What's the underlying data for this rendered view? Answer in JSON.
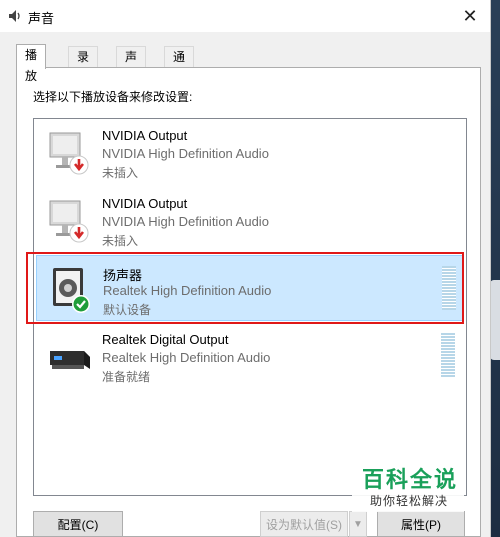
{
  "window": {
    "title": "声音",
    "close_glyph": "✕"
  },
  "tabs": [
    {
      "label": "播放",
      "active": true
    },
    {
      "label": "录制",
      "active": false
    },
    {
      "label": "声音",
      "active": false
    },
    {
      "label": "通信",
      "active": false
    }
  ],
  "instruction": "选择以下播放设备来修改设置:",
  "devices": [
    {
      "name": "NVIDIA Output",
      "driver": "NVIDIA High Definition Audio",
      "status": "未插入",
      "icon": "monitor-icon",
      "badge": "unplugged-red-arrow-icon"
    },
    {
      "name": "NVIDIA Output",
      "driver": "NVIDIA High Definition Audio",
      "status": "未插入",
      "icon": "monitor-icon",
      "badge": "unplugged-red-arrow-icon"
    },
    {
      "name": "扬声器",
      "driver": "Realtek High Definition Audio",
      "status": "默认设备",
      "icon": "speaker-icon",
      "badge": "default-checkmark-icon",
      "selected": true
    },
    {
      "name": "Realtek Digital Output",
      "driver": "Realtek High Definition Audio",
      "status": "准备就绪",
      "icon": "digital-output-icon"
    }
  ],
  "buttons": {
    "configure": "配置(C)",
    "set_default": "设为默认值(S)",
    "set_default_arrow": "▼",
    "properties": "属性(P)"
  },
  "watermark": {
    "title": "百科全说",
    "subtitle": "助你轻松解决"
  },
  "colors": {
    "selection": "#cce8ff",
    "highlight_box": "#e01818",
    "watermark_green": "#1aa05a"
  }
}
